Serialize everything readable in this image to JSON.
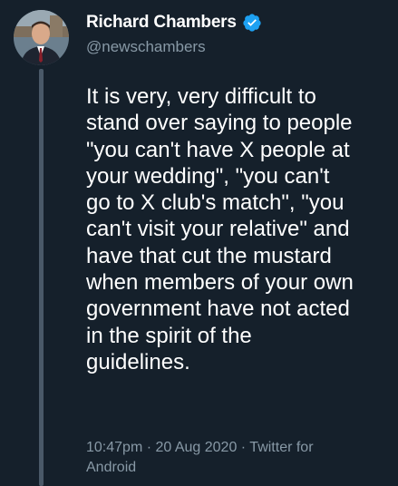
{
  "tweet": {
    "author": {
      "display_name": "Richard Chambers",
      "handle": "@newschambers",
      "verified": true
    },
    "text": "It is very, very difficult to\nstand over saying to people\n\"you can't have X people at\nyour wedding\", \"you can't\ngo to X club's match\", \"you\ncan't visit your relative\" and\nhave that cut the mustard\nwhen members of your own\ngovernment have not acted\nin the spirit of the\nguidelines.",
    "time": "10:47pm",
    "separator": " · ",
    "date": "20 Aug 2020",
    "source": "Twitter for Android"
  },
  "colors": {
    "background": "#15202b",
    "text": "#ffffff",
    "secondary_text": "#8899a6",
    "verified_badge": "#1da1f2",
    "thread_line": "#4a5968"
  },
  "icons": {
    "avatar": "profile-photo",
    "verified": "verified-badge-icon"
  }
}
